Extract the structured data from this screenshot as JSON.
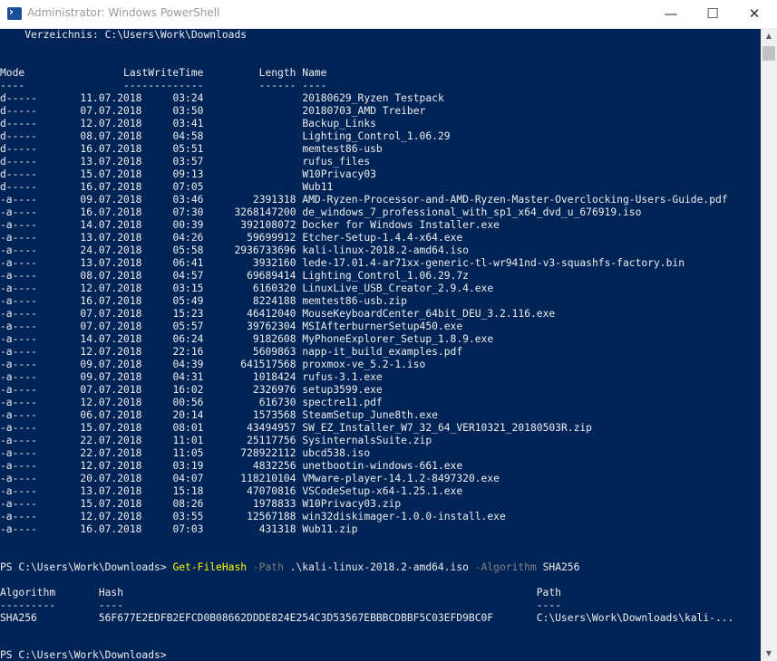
{
  "window": {
    "title": "Administrator: Windows PowerShell",
    "minimize": "—",
    "maximize": "☐",
    "close": "✕"
  },
  "console": {
    "dir_header": "    Verzeichnis: C:\\Users\\Work\\Downloads",
    "col_header": "Mode                LastWriteTime         Length Name",
    "col_underline": "----                -------------         ------ ----",
    "files": [
      {
        "mode": "d-----",
        "date": "11.07.2018",
        "time": "03:24",
        "length": "",
        "name": "20180629_Ryzen Testpack"
      },
      {
        "mode": "d-----",
        "date": "07.07.2018",
        "time": "03:50",
        "length": "",
        "name": "20180703_AMD Treiber"
      },
      {
        "mode": "d-----",
        "date": "12.07.2018",
        "time": "03:41",
        "length": "",
        "name": "Backup_Links"
      },
      {
        "mode": "d-----",
        "date": "08.07.2018",
        "time": "04:58",
        "length": "",
        "name": "Lighting_Control_1.06.29"
      },
      {
        "mode": "d-----",
        "date": "16.07.2018",
        "time": "05:51",
        "length": "",
        "name": "memtest86-usb"
      },
      {
        "mode": "d-----",
        "date": "13.07.2018",
        "time": "03:57",
        "length": "",
        "name": "rufus_files"
      },
      {
        "mode": "d-----",
        "date": "15.07.2018",
        "time": "09:13",
        "length": "",
        "name": "W10Privacy03"
      },
      {
        "mode": "d-----",
        "date": "16.07.2018",
        "time": "07:05",
        "length": "",
        "name": "Wub11"
      },
      {
        "mode": "-a----",
        "date": "09.07.2018",
        "time": "03:46",
        "length": "2391318",
        "name": "AMD-Ryzen-Processor-and-AMD-Ryzen-Master-Overclocking-Users-Guide.pdf"
      },
      {
        "mode": "-a----",
        "date": "16.07.2018",
        "time": "07:30",
        "length": "3268147200",
        "name": "de_windows_7_professional_with_sp1_x64_dvd_u_676919.iso"
      },
      {
        "mode": "-a----",
        "date": "14.07.2018",
        "time": "00:39",
        "length": "392108072",
        "name": "Docker for Windows Installer.exe"
      },
      {
        "mode": "-a----",
        "date": "13.07.2018",
        "time": "04:26",
        "length": "59699912",
        "name": "Etcher-Setup-1.4.4-x64.exe"
      },
      {
        "mode": "-a----",
        "date": "24.07.2018",
        "time": "05:58",
        "length": "2936733696",
        "name": "kali-linux-2018.2-amd64.iso"
      },
      {
        "mode": "-a----",
        "date": "13.07.2018",
        "time": "06:41",
        "length": "3932160",
        "name": "lede-17.01.4-ar71xx-generic-tl-wr941nd-v3-squashfs-factory.bin"
      },
      {
        "mode": "-a----",
        "date": "08.07.2018",
        "time": "04:57",
        "length": "69689414",
        "name": "Lighting_Control_1.06.29.7z"
      },
      {
        "mode": "-a----",
        "date": "12.07.2018",
        "time": "03:15",
        "length": "6160320",
        "name": "LinuxLive_USB_Creator_2.9.4.exe"
      },
      {
        "mode": "-a----",
        "date": "16.07.2018",
        "time": "05:49",
        "length": "8224188",
        "name": "memtest86-usb.zip"
      },
      {
        "mode": "-a----",
        "date": "07.07.2018",
        "time": "15:23",
        "length": "46412040",
        "name": "MouseKeyboardCenter_64bit_DEU_3.2.116.exe"
      },
      {
        "mode": "-a----",
        "date": "07.07.2018",
        "time": "05:57",
        "length": "39762304",
        "name": "MSIAfterburnerSetup450.exe"
      },
      {
        "mode": "-a----",
        "date": "14.07.2018",
        "time": "06:24",
        "length": "9182608",
        "name": "MyPhoneExplorer_Setup_1.8.9.exe"
      },
      {
        "mode": "-a----",
        "date": "12.07.2018",
        "time": "22:16",
        "length": "5609863",
        "name": "napp-it_build_examples.pdf"
      },
      {
        "mode": "-a----",
        "date": "09.07.2018",
        "time": "04:39",
        "length": "641517568",
        "name": "proxmox-ve_5.2-1.iso"
      },
      {
        "mode": "-a----",
        "date": "09.07.2018",
        "time": "04:31",
        "length": "1018424",
        "name": "rufus-3.1.exe"
      },
      {
        "mode": "-a----",
        "date": "07.07.2018",
        "time": "16:02",
        "length": "2326976",
        "name": "setup3599.exe"
      },
      {
        "mode": "-a----",
        "date": "12.07.2018",
        "time": "00:56",
        "length": "616730",
        "name": "spectre11.pdf"
      },
      {
        "mode": "-a----",
        "date": "06.07.2018",
        "time": "20:14",
        "length": "1573568",
        "name": "SteamSetup_June8th.exe"
      },
      {
        "mode": "-a----",
        "date": "15.07.2018",
        "time": "08:01",
        "length": "43494957",
        "name": "SW_EZ_Installer_W7_32_64_VER10321_20180503R.zip"
      },
      {
        "mode": "-a----",
        "date": "22.07.2018",
        "time": "11:01",
        "length": "25117756",
        "name": "SysinternalsSuite.zip"
      },
      {
        "mode": "-a----",
        "date": "22.07.2018",
        "time": "11:05",
        "length": "728922112",
        "name": "ubcd538.iso"
      },
      {
        "mode": "-a----",
        "date": "12.07.2018",
        "time": "03:19",
        "length": "4832256",
        "name": "unetbootin-windows-661.exe"
      },
      {
        "mode": "-a----",
        "date": "20.07.2018",
        "time": "04:07",
        "length": "118210104",
        "name": "VMware-player-14.1.2-8497320.exe"
      },
      {
        "mode": "-a----",
        "date": "13.07.2018",
        "time": "15:18",
        "length": "47070816",
        "name": "VSCodeSetup-x64-1.25.1.exe"
      },
      {
        "mode": "-a----",
        "date": "15.07.2018",
        "time": "08:26",
        "length": "1978833",
        "name": "W10Privacy03.zip"
      },
      {
        "mode": "-a----",
        "date": "12.07.2018",
        "time": "03:55",
        "length": "12567188",
        "name": "win32diskimager-1.0.0-install.exe"
      },
      {
        "mode": "-a----",
        "date": "16.07.2018",
        "time": "07:03",
        "length": "431318",
        "name": "Wub11.zip"
      }
    ],
    "prompt": "PS C:\\Users\\Work\\Downloads> ",
    "command": {
      "cmdlet": "Get-FileHash",
      "param1": "-Path",
      "value1": ".\\kali-linux-2018.2-amd64.iso",
      "param2": "-Algorithm",
      "value2": "SHA256"
    },
    "hash_header": "Algorithm       Hash                                                                   Path",
    "hash_underline": "---------       ----                                                                   ----",
    "hash_row": "SHA256          56F677E2EDFB2EFCD0B08662DDDE824E254C3D53567EBBBCDBBF5C03EFD9BC0F       C:\\Users\\Work\\Downloads\\kali-...",
    "final_prompt": "PS C:\\Users\\Work\\Downloads>"
  },
  "scrollbar": {
    "up": "▲",
    "down": "▼"
  }
}
